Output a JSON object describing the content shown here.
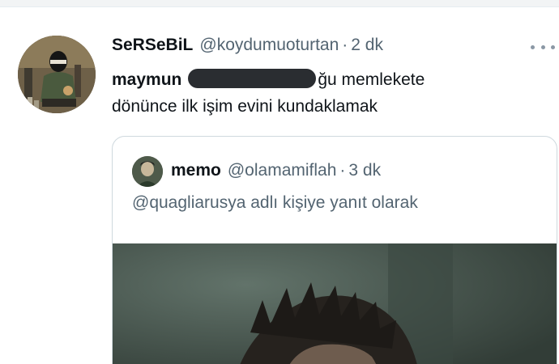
{
  "tweet": {
    "display_name": "SeRSeBiL",
    "handle": "@koydumuoturtan",
    "separator": "·",
    "time": "2 dk",
    "text_start": "maymun",
    "text_rest": "ğu memlekete",
    "text_line2": "dönünce ilk işim evini kundaklamak"
  },
  "quoted_tweet": {
    "display_name": "memo",
    "handle": "@olamamiflah",
    "separator": "·",
    "time": "3 dk",
    "reply_text": "@quagliarusya adlı kişiye yanıt olarak"
  },
  "icons": {
    "more": "more-horizontal-icon"
  },
  "colors": {
    "text_primary": "#0f1419",
    "text_secondary": "#536471",
    "border": "#cfd9de",
    "redaction": "#2a2d31"
  }
}
